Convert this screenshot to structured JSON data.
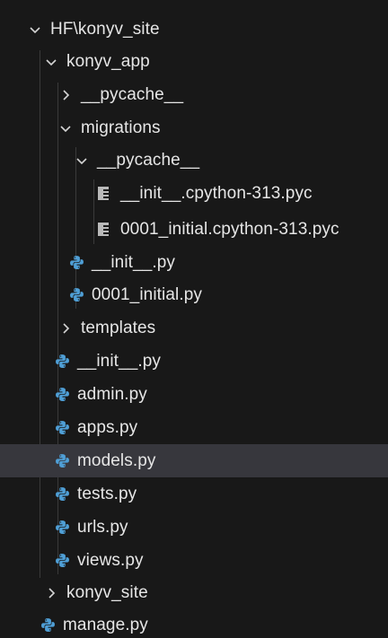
{
  "explorer": {
    "root": {
      "label": "HF\\konyv_site",
      "icon": "chevron-down-icon"
    },
    "rows": [
      {
        "label": "konyv_app",
        "icon": "chevron-down-icon"
      },
      {
        "label": "__pycache__",
        "icon": "chevron-right-icon"
      },
      {
        "label": "migrations",
        "icon": "chevron-down-icon"
      },
      {
        "label": "__pycache__",
        "icon": "chevron-down-icon"
      },
      {
        "label": "__init__.cpython-313.pyc",
        "icon": "binary-file-icon"
      },
      {
        "label": "0001_initial.cpython-313.pyc",
        "icon": "binary-file-icon"
      },
      {
        "label": "__init__.py",
        "icon": "python-icon"
      },
      {
        "label": "0001_initial.py",
        "icon": "python-icon"
      },
      {
        "label": "templates",
        "icon": "chevron-right-icon"
      },
      {
        "label": "__init__.py",
        "icon": "python-icon"
      },
      {
        "label": "admin.py",
        "icon": "python-icon"
      },
      {
        "label": "apps.py",
        "icon": "python-icon"
      },
      {
        "label": "models.py",
        "icon": "python-icon",
        "selected": true
      },
      {
        "label": "tests.py",
        "icon": "python-icon"
      },
      {
        "label": "urls.py",
        "icon": "python-icon"
      },
      {
        "label": "views.py",
        "icon": "python-icon"
      },
      {
        "label": "konyv_site",
        "icon": "chevron-right-icon"
      },
      {
        "label": "manage.py",
        "icon": "python-icon"
      }
    ]
  },
  "colors": {
    "background": "#181818",
    "selected_row": "#37373d",
    "text": "#e6e6e6",
    "python_icon": "#4f9fd6",
    "binary_icon": "#b9b9b9",
    "indent_guide": "#3a3a3a"
  }
}
